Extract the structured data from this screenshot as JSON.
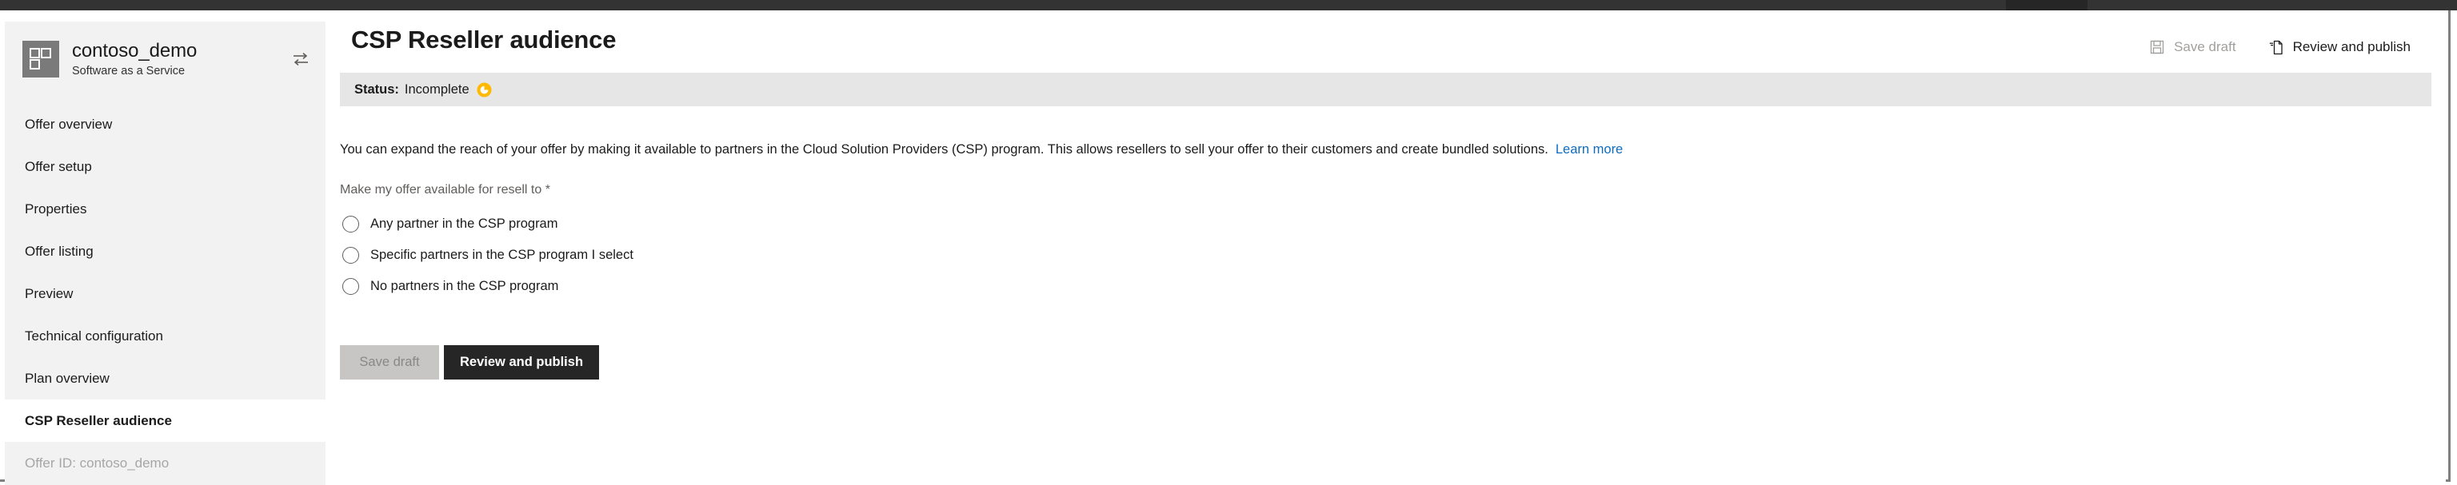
{
  "window": {
    "chrome_color": "#333333",
    "chrome_tab_color": "#262626"
  },
  "sidebar": {
    "offer": {
      "name": "contoso_demo",
      "type": "Software as a Service",
      "logo_icon": "app-grid-icon",
      "swap_icon": "swap-arrows-icon"
    },
    "items": [
      {
        "label": "Offer overview",
        "state": "default"
      },
      {
        "label": "Offer setup",
        "state": "default"
      },
      {
        "label": "Properties",
        "state": "default"
      },
      {
        "label": "Offer listing",
        "state": "default"
      },
      {
        "label": "Preview",
        "state": "default"
      },
      {
        "label": "Technical configuration",
        "state": "default"
      },
      {
        "label": "Plan overview",
        "state": "default"
      },
      {
        "label": "CSP Reseller audience",
        "state": "active"
      },
      {
        "label": "Offer ID: contoso_demo",
        "state": "muted"
      }
    ]
  },
  "header": {
    "title": "CSP Reseller audience",
    "commands": [
      {
        "label": "Save draft",
        "icon": "save-disk-icon",
        "disabled": true
      },
      {
        "label": "Review and publish",
        "icon": "publish-page-icon",
        "disabled": false
      }
    ]
  },
  "status": {
    "label": "Status:",
    "value": "Incomplete",
    "icon": "incomplete-clock-icon",
    "icon_color": "#ffb900",
    "bar_color": "#e6e6e6"
  },
  "main": {
    "intro_text": "You can expand the reach of your offer by making it available to partners in the Cloud Solution Providers (CSP) program. This allows resellers to sell your offer to their customers and create bundled solutions.",
    "learn_more_label": "Learn more",
    "field_label": "Make my offer available for resell to *",
    "radio_options": [
      {
        "label": "Any partner in the CSP program",
        "checked": false
      },
      {
        "label": "Specific partners in the CSP program I select",
        "checked": false
      },
      {
        "label": "No partners in the CSP program",
        "checked": false
      }
    ],
    "buttons": {
      "save_draft": "Save draft",
      "review_publish": "Review and publish"
    }
  },
  "colors": {
    "link": "#0f6cbd",
    "primary_button": "#262626",
    "sidebar_bg": "#f2f2f2"
  }
}
